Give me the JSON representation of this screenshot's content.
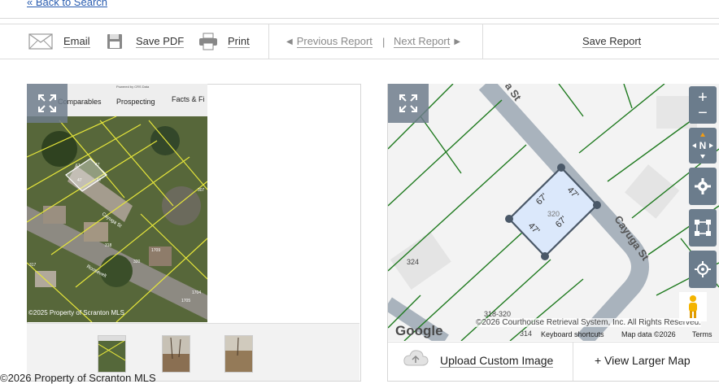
{
  "back_link": "« Back to Search",
  "toolbar": {
    "email": "Email",
    "save_pdf": "Save PDF",
    "print": "Print",
    "previous_report": "Previous Report",
    "separator": "|",
    "next_report": "Next Report",
    "save_report": "Save Report"
  },
  "photo": {
    "tabs": [
      "Comparables",
      "Prospecting",
      "Facts & Fi"
    ],
    "powered_by": "Powered by CRS Data",
    "street_label": "Cayuga St",
    "street_label_2": "Roosevelt",
    "lot_numbers": [
      "317",
      "307",
      "1709",
      "1704",
      "1705",
      "318",
      "320"
    ],
    "lot_dims": [
      "67",
      "67",
      "47",
      "47"
    ],
    "copyright": "©2025 Property of Scranton MLS"
  },
  "map": {
    "street_top": "a St",
    "street_right": "Cayuga St",
    "lot_number": "320",
    "dims": [
      "67'",
      "47'",
      "47'",
      "67'"
    ],
    "neighbor_lot": "324",
    "neighbor_range": "318-320",
    "neighbor_bottom": "314",
    "compass": "N",
    "copyright": "©2026 Courthouse Retrieval System, Inc. All Rights Reserved.",
    "google": "Google",
    "keyboard_shortcuts": "Keyboard shortcuts",
    "map_data": "Map data ©2026",
    "terms": "Terms",
    "upload_custom_image": "Upload Custom Image",
    "view_larger_map": "+ View Larger Map"
  },
  "footer_copyright": "©2026 Property of Scranton MLS",
  "colors": {
    "parcel_lines": "#1f7a1f",
    "road": "#a9b3bd",
    "selected_lot": "#dbe8fb",
    "control_bg": "#6b7c8c",
    "link": "#2a5db0"
  }
}
